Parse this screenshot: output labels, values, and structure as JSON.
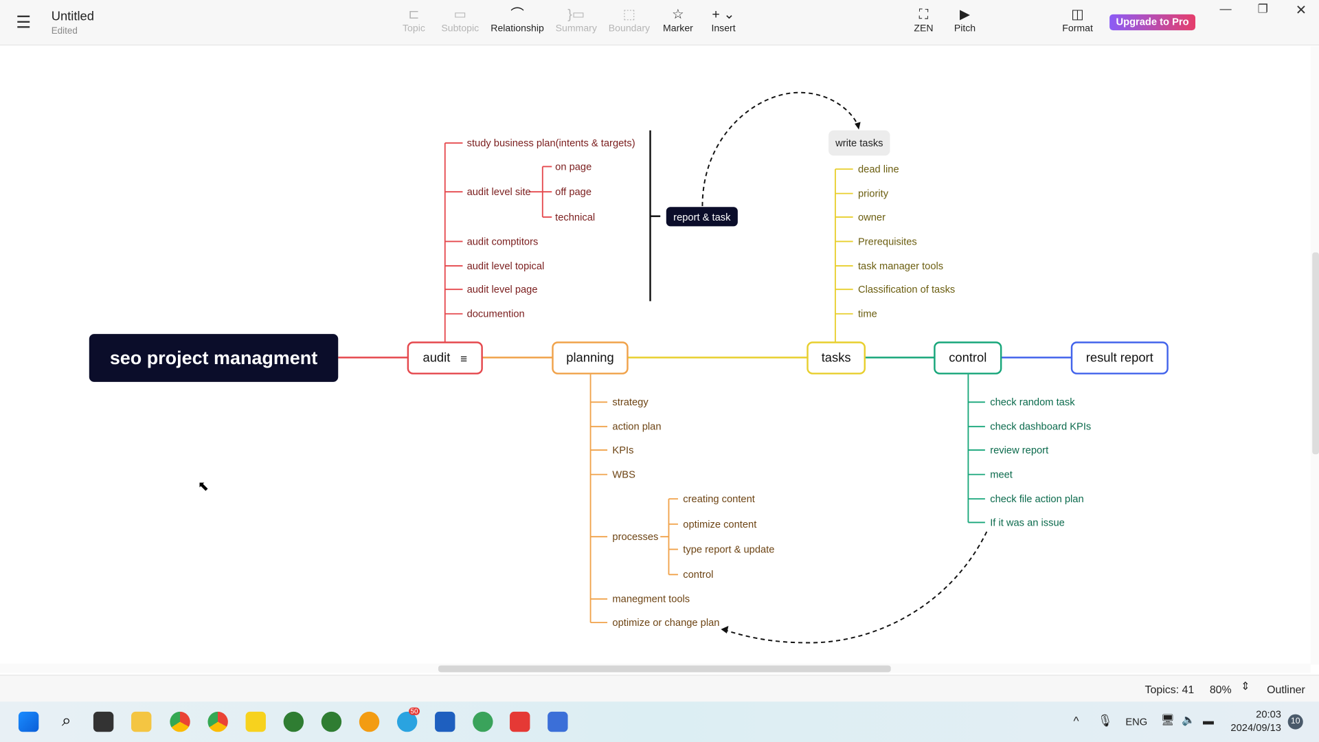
{
  "header": {
    "title": "Untitled",
    "subtitle": "Edited",
    "menu_icon": "hamburger-icon",
    "tools": [
      {
        "label": "Topic",
        "enabled": false,
        "icon": "topic-icon"
      },
      {
        "label": "Subtopic",
        "enabled": false,
        "icon": "subtopic-icon"
      },
      {
        "label": "Relationship",
        "enabled": true,
        "icon": "relationship-icon"
      },
      {
        "label": "Summary",
        "enabled": false,
        "icon": "summary-icon"
      },
      {
        "label": "Boundary",
        "enabled": false,
        "icon": "boundary-icon"
      },
      {
        "label": "Marker",
        "enabled": true,
        "icon": "star-icon"
      },
      {
        "label": "Insert",
        "enabled": true,
        "icon": "plus-icon"
      }
    ],
    "zen": "ZEN",
    "pitch": "Pitch",
    "format": "Format",
    "upgrade": "Upgrade to Pro"
  },
  "map": {
    "root": "seo project managment",
    "audit": {
      "label": "audit",
      "color": "#e5484d",
      "children": [
        "study business plan(intents & targets)",
        "audit level site",
        "audit comptitors",
        "audit level topical",
        "audit level page",
        "documention"
      ],
      "site_children": [
        "on page",
        "off page",
        "technical"
      ]
    },
    "report": {
      "label": "report & task"
    },
    "write_tasks": "write tasks",
    "planning": {
      "label": "planning",
      "color": "#f0a24a",
      "children": [
        "strategy",
        "action plan",
        "KPIs",
        "WBS",
        "processes",
        "manegment tools",
        "optimize or change plan"
      ],
      "process_children": [
        "creating content",
        "optimize content",
        "type report & update",
        "control"
      ]
    },
    "tasks": {
      "label": "tasks",
      "color": "#e8cf2e",
      "children": [
        "dead line",
        "priority",
        "owner",
        "Prerequisites",
        "task manager tools",
        "Classification of tasks",
        "time"
      ]
    },
    "control": {
      "label": "control",
      "color": "#17a67a",
      "children": [
        "check random task",
        "check dashboard KPIs",
        "review report",
        "meet",
        "check file action plan",
        "If it was an issue"
      ]
    },
    "result": {
      "label": "result report",
      "color": "#4263eb"
    }
  },
  "status": {
    "topics": "Topics: 41",
    "zoom": "80%",
    "outliner": "Outliner"
  },
  "taskbar": {
    "lang": "ENG",
    "time": "20:03",
    "date": "2024/09/13",
    "notifications": "10",
    "telegram_badge": "50"
  }
}
